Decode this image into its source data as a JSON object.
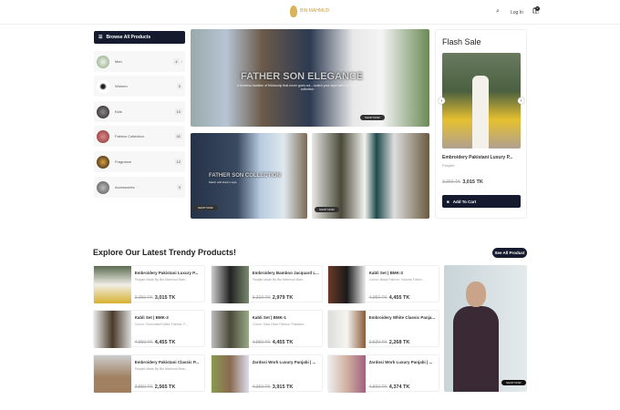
{
  "header": {
    "logo_text": "BIN MAHMUD",
    "login": "Log In",
    "cart_count": "0"
  },
  "sidebar": {
    "title": "Browse All Products",
    "items": [
      {
        "label": "Men",
        "count": "4"
      },
      {
        "label": "Women",
        "count": "0"
      },
      {
        "label": "Kids",
        "count": "10"
      },
      {
        "label": "Fabrics Collection",
        "count": "41"
      },
      {
        "label": "Fragrance",
        "count": "12"
      },
      {
        "label": "Accessories",
        "count": "0"
      }
    ]
  },
  "banners": {
    "main_title": "FATHER SON ELEGANCE",
    "main_sub": "A timeless tradition of fellowship that never goes out – match your style with our Father-Son Panjabi collection",
    "main_btn": "SHOP NOW",
    "sub1_title": "FATHER SON COLLECTION",
    "sub1_sub": "Match with Dad in style",
    "sub1_btn": "SHOP NOW",
    "sub2_btn": "SHOP NOW"
  },
  "flash": {
    "title": "Flash Sale",
    "name": "Embroidery Pakistani Luxury P...",
    "category": "Panjabi",
    "old": "3,350 TK",
    "new": "3,015 TK",
    "cart_btn": "Add To Cart"
  },
  "section": {
    "title": "Explore Our Latest Trendy Products!",
    "see_all": "See All Product",
    "promo_btn": "SHOP NOW"
  },
  "products": [
    {
      "name": "Embroidery Pakistani Luxury P...",
      "desc": "Panjabi Made By Bin Mahmud Bran...",
      "old": "3,350 TK",
      "new": "3,015 TK"
    },
    {
      "name": "Embroidery Bamboo Jacquard L...",
      "desc": "Panjabi Made By Bin Mahmud Bran...",
      "old": "3,310 TK",
      "new": "2,979 TK"
    },
    {
      "name": "Kabli Set | BMK-3",
      "desc": "Colour: Black Fabrics: Viscose Fabric...",
      "old": "4,950 TK",
      "new": "4,455 TK"
    },
    {
      "name": "Kabli Set | BMK-2",
      "desc": "Colour: Chocolate/Coffee Fabrics: P...",
      "old": "4,950 TK",
      "new": "4,455 TK"
    },
    {
      "name": "Kabli Set | BMK-1",
      "desc": "Colour: Dark Olive Fabrics: Pakistan...",
      "old": "4,950 TK",
      "new": "4,455 TK"
    },
    {
      "name": "Embroidery White Classic Panja...",
      "desc": "",
      "old": "2,520 TK",
      "new": "2,268 TK"
    },
    {
      "name": "Embroidery Pakistani Classic P...",
      "desc": "Panjabi Made By Bin Mahmud Bran...",
      "old": "2,850 TK",
      "new": "2,565 TK"
    },
    {
      "name": "Zardosi Work Luxury Panjabi | ...",
      "desc": "",
      "old": "4,350 TK",
      "new": "3,915 TK"
    },
    {
      "name": "Zardosi Work Luxury Panjabi | ...",
      "desc": "",
      "old": "4,860 TK",
      "new": "4,374 TK"
    }
  ]
}
